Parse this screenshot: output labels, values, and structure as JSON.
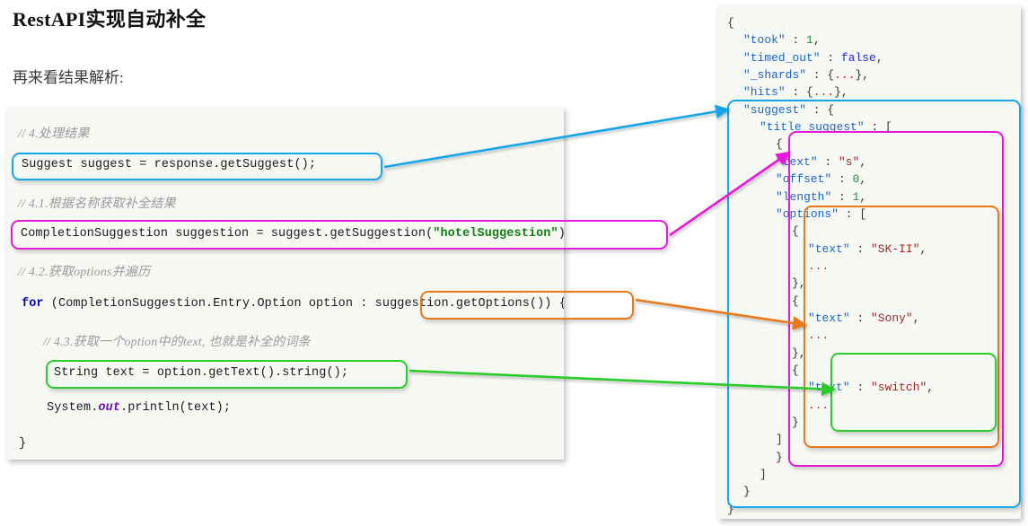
{
  "page": {
    "title": "RestAPI实现自动补全",
    "lead": "再来看结果解析:"
  },
  "colors": {
    "blue": "#18a5e8",
    "magenta": "#e818d8",
    "orange": "#e8791a",
    "green": "#2ccc2c",
    "panel_bg": "#f6f8f3",
    "json_key": "#1b63c9",
    "json_string": "#9e2222",
    "json_number": "#1f8a3c",
    "json_boolean": "#2222dd",
    "json_ellipsis": "#cc2222",
    "code_comment": "#9a9a9a",
    "code_keyword": "#0000c0",
    "code_string_literal": "#127d12"
  },
  "code_panel": {
    "lines": [
      {
        "id": "c1",
        "kind": "comment",
        "text": "// 4.处理结果"
      },
      {
        "id": "c2",
        "kind": "code",
        "text": "Suggest suggest = response.getSuggest();"
      },
      {
        "id": "c3",
        "kind": "comment",
        "text": "// 4.1.根据名称获取补全结果"
      },
      {
        "id": "c4",
        "kind": "code",
        "pre": "CompletionSuggestion suggestion = suggest.getSuggestion(",
        "literal": "\"hotelSuggestion\"",
        "post": ");"
      },
      {
        "id": "c5",
        "kind": "comment",
        "text": "// 4.2.获取options并遍历"
      },
      {
        "id": "c6",
        "kind": "code",
        "keyword": "for",
        "rest": " (CompletionSuggestion.Entry.Option option : suggestion.getOptions()) {"
      },
      {
        "id": "c7",
        "kind": "comment",
        "text": "// 4.3.获取一个option中的text, 也就是补全的词条"
      },
      {
        "id": "c8",
        "kind": "code",
        "text": "String text = option.getText().string();"
      },
      {
        "id": "c9",
        "kind": "code",
        "pre": "System.",
        "keyword": "out",
        "post": ".println(text);"
      },
      {
        "id": "c10",
        "kind": "code",
        "text": "}"
      }
    ]
  },
  "json_panel": {
    "lines": [
      {
        "id": "j1",
        "indent": 0,
        "segments": [
          {
            "t": "{",
            "c": "j-punc"
          }
        ]
      },
      {
        "id": "j2",
        "indent": 1,
        "segments": [
          {
            "t": "\"took\"",
            "c": "j-key"
          },
          {
            "t": " : ",
            "c": "j-punc"
          },
          {
            "t": "1",
            "c": "j-num"
          },
          {
            "t": ",",
            "c": "j-punc"
          }
        ]
      },
      {
        "id": "j3",
        "indent": 1,
        "segments": [
          {
            "t": "\"timed_out\"",
            "c": "j-key"
          },
          {
            "t": " : ",
            "c": "j-punc"
          },
          {
            "t": "false",
            "c": "j-bool"
          },
          {
            "t": ",",
            "c": "j-punc"
          }
        ]
      },
      {
        "id": "j4",
        "indent": 1,
        "segments": [
          {
            "t": "\"_shards\"",
            "c": "j-key"
          },
          {
            "t": " : {",
            "c": "j-punc"
          },
          {
            "t": "...",
            "c": "j-dots"
          },
          {
            "t": "},",
            "c": "j-punc"
          }
        ]
      },
      {
        "id": "j5",
        "indent": 1,
        "segments": [
          {
            "t": "\"hits\"",
            "c": "j-key"
          },
          {
            "t": " : {",
            "c": "j-punc"
          },
          {
            "t": "...",
            "c": "j-dots"
          },
          {
            "t": "},",
            "c": "j-punc"
          }
        ]
      },
      {
        "id": "j6",
        "indent": 1,
        "segments": [
          {
            "t": "\"suggest\"",
            "c": "j-key"
          },
          {
            "t": " : {",
            "c": "j-punc"
          }
        ]
      },
      {
        "id": "j7",
        "indent": 2,
        "segments": [
          {
            "t": "\"title_suggest\"",
            "c": "j-key"
          },
          {
            "t": " : [",
            "c": "j-punc"
          }
        ]
      },
      {
        "id": "j8",
        "indent": 3,
        "segments": [
          {
            "t": "{",
            "c": "j-punc"
          }
        ]
      },
      {
        "id": "j9",
        "indent": 3,
        "segments": [
          {
            "t": "\"text\"",
            "c": "j-key"
          },
          {
            "t": " : ",
            "c": "j-punc"
          },
          {
            "t": "\"s\"",
            "c": "j-str"
          },
          {
            "t": ",",
            "c": "j-punc"
          }
        ]
      },
      {
        "id": "j10",
        "indent": 3,
        "segments": [
          {
            "t": "\"offset\"",
            "c": "j-key"
          },
          {
            "t": " : ",
            "c": "j-punc"
          },
          {
            "t": "0",
            "c": "j-num"
          },
          {
            "t": ",",
            "c": "j-punc"
          }
        ]
      },
      {
        "id": "j11",
        "indent": 3,
        "segments": [
          {
            "t": "\"length\"",
            "c": "j-key"
          },
          {
            "t": " : ",
            "c": "j-punc"
          },
          {
            "t": "1",
            "c": "j-num"
          },
          {
            "t": ",",
            "c": "j-punc"
          }
        ]
      },
      {
        "id": "j12",
        "indent": 3,
        "segments": [
          {
            "t": "\"options\"",
            "c": "j-key"
          },
          {
            "t": " : [",
            "c": "j-punc"
          }
        ]
      },
      {
        "id": "j13",
        "indent": 4,
        "segments": [
          {
            "t": "{",
            "c": "j-punc"
          }
        ]
      },
      {
        "id": "j14",
        "indent": 5,
        "segments": [
          {
            "t": "\"text\"",
            "c": "j-key"
          },
          {
            "t": " : ",
            "c": "j-punc"
          },
          {
            "t": "\"SK-II\"",
            "c": "j-str"
          },
          {
            "t": ",",
            "c": "j-punc"
          }
        ]
      },
      {
        "id": "j15",
        "indent": 5,
        "segments": [
          {
            "t": "...",
            "c": "j-dots"
          }
        ]
      },
      {
        "id": "j16",
        "indent": 4,
        "segments": [
          {
            "t": "},",
            "c": "j-punc"
          }
        ]
      },
      {
        "id": "j17",
        "indent": 4,
        "segments": [
          {
            "t": "{",
            "c": "j-punc"
          }
        ]
      },
      {
        "id": "j18",
        "indent": 5,
        "segments": [
          {
            "t": "\"text\"",
            "c": "j-key"
          },
          {
            "t": " : ",
            "c": "j-punc"
          },
          {
            "t": "\"Sony\"",
            "c": "j-str"
          },
          {
            "t": ",",
            "c": "j-punc"
          }
        ]
      },
      {
        "id": "j19",
        "indent": 5,
        "segments": [
          {
            "t": "...",
            "c": "j-dots"
          }
        ]
      },
      {
        "id": "j20",
        "indent": 4,
        "segments": [
          {
            "t": "},",
            "c": "j-punc"
          }
        ]
      },
      {
        "id": "j21",
        "indent": 4,
        "segments": [
          {
            "t": "{",
            "c": "j-punc"
          }
        ]
      },
      {
        "id": "j22",
        "indent": 5,
        "segments": [
          {
            "t": "\"text\"",
            "c": "j-key"
          },
          {
            "t": " : ",
            "c": "j-punc"
          },
          {
            "t": "\"switch\"",
            "c": "j-str"
          },
          {
            "t": ",",
            "c": "j-punc"
          }
        ]
      },
      {
        "id": "j23",
        "indent": 5,
        "segments": [
          {
            "t": "...",
            "c": "j-dots"
          }
        ]
      },
      {
        "id": "j24",
        "indent": 4,
        "segments": [
          {
            "t": "}",
            "c": "j-punc"
          }
        ]
      },
      {
        "id": "j25",
        "indent": 3,
        "segments": [
          {
            "t": "]",
            "c": "j-punc"
          }
        ]
      },
      {
        "id": "j26",
        "indent": 3,
        "segments": [
          {
            "t": "}",
            "c": "j-punc"
          }
        ]
      },
      {
        "id": "j27",
        "indent": 2,
        "segments": [
          {
            "t": "]",
            "c": "j-punc"
          }
        ]
      },
      {
        "id": "j28",
        "indent": 1,
        "segments": [
          {
            "t": "}",
            "c": "j-punc"
          }
        ]
      },
      {
        "id": "j29",
        "indent": 0,
        "segments": [
          {
            "t": "}",
            "c": "j-punc"
          }
        ]
      }
    ]
  },
  "annotations": [
    {
      "id": "a-blue",
      "color": "#18a5e8",
      "source": "Suggest suggest = response.getSuggest();",
      "target": "\"suggest\" : {"
    },
    {
      "id": "a-magenta",
      "color": "#e818d8",
      "source": "CompletionSuggestion suggestion = suggest.getSuggestion(\"hotelSuggestion\");",
      "target": "\"title_suggest\" : ["
    },
    {
      "id": "a-orange",
      "color": "#e8791a",
      "source": "suggestion.getOptions()) {",
      "target": "\"options\" : ["
    },
    {
      "id": "a-green",
      "color": "#2ccc2c",
      "source": "String text = option.getText().string();",
      "target": "\"text\" : \"switch\","
    }
  ]
}
